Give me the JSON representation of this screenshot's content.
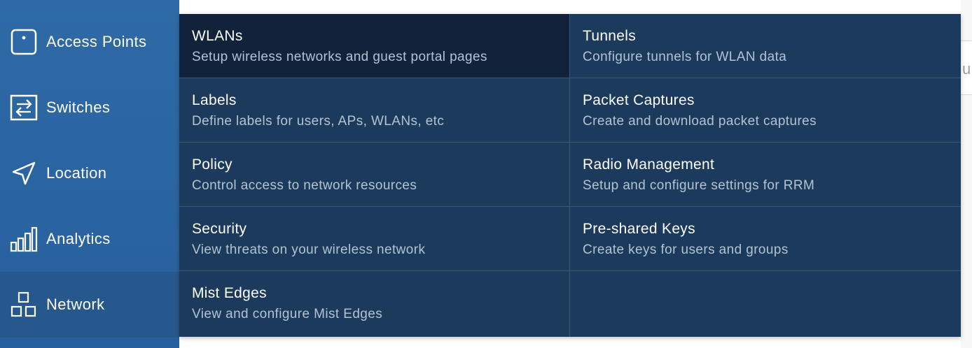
{
  "sidebar": {
    "items": [
      {
        "label": "Access Points",
        "icon": "access-point-icon"
      },
      {
        "label": "Switches",
        "icon": "switch-icon"
      },
      {
        "label": "Location",
        "icon": "location-arrow-icon"
      },
      {
        "label": "Analytics",
        "icon": "bar-chart-icon"
      },
      {
        "label": "Network",
        "icon": "network-icon",
        "active": true
      }
    ]
  },
  "menu": {
    "left": [
      {
        "title": "WLANs",
        "description": "Setup wireless networks and guest portal pages",
        "highlighted": true
      },
      {
        "title": "Labels",
        "description": "Define labels for users, APs, WLANs, etc"
      },
      {
        "title": "Policy",
        "description": "Control access to network resources"
      },
      {
        "title": "Security",
        "description": "View threats on your wireless network"
      },
      {
        "title": "Mist Edges",
        "description": "View and configure Mist Edges"
      }
    ],
    "right": [
      {
        "title": "Tunnels",
        "description": "Configure tunnels for WLAN data"
      },
      {
        "title": "Packet Captures",
        "description": "Create and download packet captures"
      },
      {
        "title": "Radio Management",
        "description": "Setup and configure settings for RRM"
      },
      {
        "title": "Pre-shared Keys",
        "description": "Create keys for users and groups"
      }
    ]
  },
  "background": {
    "partial_text": "u"
  },
  "colors": {
    "sidebar": "#2f6aa6",
    "sidebar_active": "#26578d",
    "menu": "#1c3a5b",
    "menu_highlight": "#11223a",
    "description": "#b4c3d3"
  }
}
